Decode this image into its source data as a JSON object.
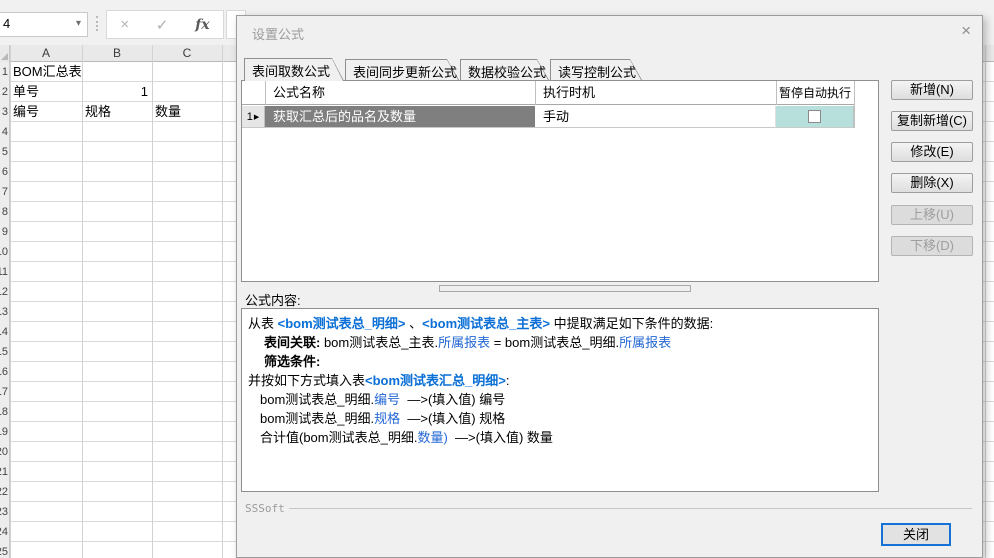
{
  "toolbar": {
    "name_box_value": "4",
    "dropdown_icon": "▾",
    "cancel_icon": "×",
    "confirm_icon": "✓",
    "fx_icon": "fx"
  },
  "spreadsheet": {
    "columns": [
      "A",
      "B",
      "C"
    ],
    "row_numbers": [
      1,
      2,
      3,
      4,
      5,
      6,
      7,
      8,
      9,
      10,
      11,
      12,
      13,
      14,
      15,
      16,
      17,
      18,
      19,
      20,
      21,
      22,
      23,
      24,
      25
    ],
    "cells": [
      {
        "ref": "A1",
        "value": "BOM汇总表"
      },
      {
        "ref": "A2",
        "value": "单号"
      },
      {
        "ref": "B2",
        "value": "1"
      },
      {
        "ref": "A3",
        "value": "编号"
      },
      {
        "ref": "B3",
        "value": "规格"
      },
      {
        "ref": "C3",
        "value": "数量"
      }
    ]
  },
  "dialog": {
    "title": "设置公式",
    "close_icon": "×",
    "tabs": [
      {
        "label": "表间取数公式",
        "active": true
      },
      {
        "label": "表间同步更新公式",
        "active": false
      },
      {
        "label": "数据校验公式",
        "active": false
      },
      {
        "label": "读写控制公式",
        "active": false
      }
    ],
    "formula_table": {
      "headers": [
        "公式名称",
        "执行时机",
        "暂停自动执行"
      ],
      "rows": [
        {
          "index": "1",
          "marker": "▶",
          "name": "获取汇总后的品名及数量",
          "timing": "手动",
          "paused_checked": false,
          "selected": true
        }
      ]
    },
    "side_buttons": [
      {
        "label": "新增(N)",
        "enabled": true
      },
      {
        "label": "复制新增(C)",
        "enabled": true
      },
      {
        "label": "修改(E)",
        "enabled": true
      },
      {
        "label": "删除(X)",
        "enabled": true
      },
      {
        "label": "上移(U)",
        "enabled": false
      },
      {
        "label": "下移(D)",
        "enabled": false
      }
    ],
    "content_label": "公式内容:",
    "content_lines": [
      [
        {
          "text": "从表 "
        },
        {
          "text": "<bom测试表总_明细>"
        },
        {
          "text": " 、"
        },
        {
          "text": "<bom测试表总_主表>"
        },
        {
          "text": " 中提取满足如下条件的数据:"
        }
      ],
      [
        {
          "text": "表间关联:"
        },
        {
          "text": " bom测试表总_主表."
        },
        {
          "text": "所属报表"
        },
        {
          "text": " = bom测试表总_明细."
        },
        {
          "text": "所属报表"
        }
      ],
      [
        {
          "text": "筛选条件:"
        }
      ],
      [
        {
          "text": ""
        }
      ],
      [
        {
          "text": "并按如下方式填入表"
        },
        {
          "text": "<bom测试表汇总_明细>"
        },
        {
          "text": ":"
        }
      ],
      [
        {
          "text": "bom测试表总_明细."
        },
        {
          "text": "编号"
        },
        {
          "text": "  —>(填入值) 编号"
        }
      ],
      [
        {
          "text": "bom测试表总_明细."
        },
        {
          "text": "规格"
        },
        {
          "text": "  —>(填入值) 规格"
        }
      ],
      [
        {
          "text": "合计值(bom测试表总_明细."
        },
        {
          "text": "数量)"
        },
        {
          "text": "  —>(填入值) 数量"
        }
      ]
    ],
    "brand": "SSSoft",
    "close_button_label": "关闭"
  },
  "colors": {
    "selected_row": "#7f7f7f",
    "paused_cell_teal": "#b7e0dc",
    "link_blue": "#0a6fd6",
    "close_button_border": "#1672d6",
    "dialog_bg": "#f0f0f0"
  }
}
